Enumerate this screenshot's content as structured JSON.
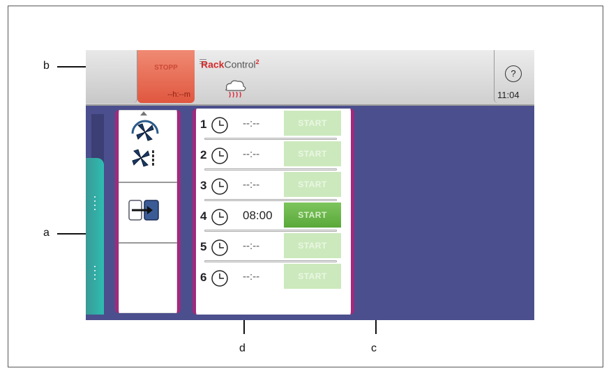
{
  "callouts": {
    "a": "a",
    "b": "b",
    "c": "c",
    "d": "d"
  },
  "topbar": {
    "stop_label": "STOPP",
    "stop_time": "--h:--m",
    "logo_rack": "Rack",
    "logo_control": "Control",
    "logo_sup": "2",
    "help_symbol": "?",
    "clock": "11:04"
  },
  "left_panel": {
    "icons": [
      "fan-speed-icon",
      "fan-off-icon",
      "exit-icon"
    ]
  },
  "timers": [
    {
      "num": "1",
      "time": "--:--",
      "button": "START",
      "active": false
    },
    {
      "num": "2",
      "time": "--:--",
      "button": "START",
      "active": false
    },
    {
      "num": "3",
      "time": "--:--",
      "button": "START",
      "active": false
    },
    {
      "num": "4",
      "time": "08:00",
      "button": "START",
      "active": true
    },
    {
      "num": "5",
      "time": "--:--",
      "button": "START",
      "active": false
    },
    {
      "num": "6",
      "time": "--:--",
      "button": "START",
      "active": false
    }
  ],
  "colors": {
    "accent": "#a02a7c",
    "background": "#4b4f8d",
    "stop": "#e0573f",
    "start_active": "#5aa83a",
    "teal": "#2dbcb2"
  }
}
